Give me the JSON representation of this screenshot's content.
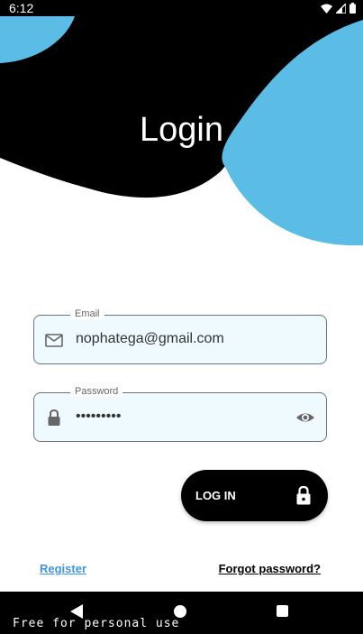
{
  "status_bar": {
    "time": "6:12"
  },
  "header": {
    "title": "Login"
  },
  "colors": {
    "accent_blue": "#5bbde6",
    "header_black": "#000000",
    "field_bg": "#eefafd",
    "link_blue": "#3f95dc"
  },
  "form": {
    "email": {
      "label": "Email",
      "value": "nophatega@gmail.com",
      "icon": "mail-icon"
    },
    "password": {
      "label": "Password",
      "value": "•••••••••",
      "icon": "lock-icon",
      "toggle_icon": "eye-icon"
    },
    "login_button": {
      "label": "LOG IN",
      "icon": "lock-icon"
    }
  },
  "links": {
    "register": "Register",
    "forgot_password": "Forgot password?"
  },
  "watermark": "Free for personal use"
}
